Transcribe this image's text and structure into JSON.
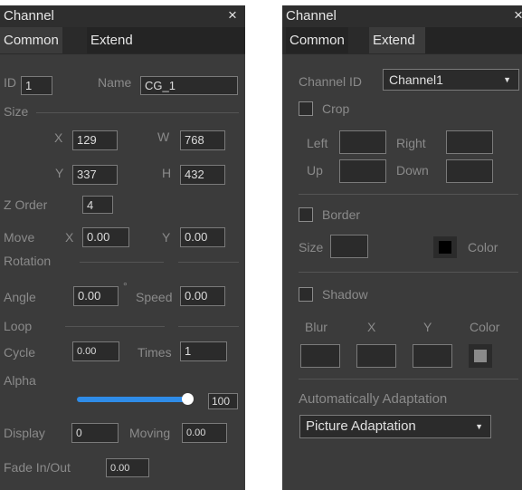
{
  "left_panel": {
    "title": "Channel",
    "close_glyph": "×",
    "tabs": [
      {
        "label": "Common",
        "active": true
      },
      {
        "label": "Extend",
        "active": false
      }
    ],
    "id_label": "ID",
    "id_value": "1",
    "name_label": "Name",
    "name_value": "CG_1",
    "size_section": "Size",
    "x_label": "X",
    "x_value": "129",
    "w_label": "W",
    "w_value": "768",
    "y_label": "Y",
    "y_value": "337",
    "h_label": "H",
    "h_value": "432",
    "zorder_label": "Z Order",
    "zorder_value": "4",
    "move_label": "Move",
    "move_x_label": "X",
    "move_x_value": "0.00",
    "move_y_label": "Y",
    "move_y_value": "0.00",
    "rotation_section": "Rotation",
    "angle_label": "Angle",
    "angle_value": "0.00",
    "degree_symbol": "°",
    "speed_label": "Speed",
    "speed_value": "0.00",
    "loop_section": "Loop",
    "cycle_label": "Cycle",
    "cycle_value": "0.00",
    "times_label": "Times",
    "times_value": "1",
    "alpha_label": "Alpha",
    "alpha_value": "100",
    "alpha_fraction": 1.0,
    "display_label": "Display",
    "display_value": "0",
    "moving_label": "Moving",
    "moving_value": "0.00",
    "fade_label": "Fade In/Out",
    "fade_value": "0.00"
  },
  "right_panel": {
    "title": "Channel",
    "close_glyph": "×",
    "tabs": [
      {
        "label": "Common",
        "active": false
      },
      {
        "label": "Extend",
        "active": true
      }
    ],
    "channel_id_label": "Channel ID",
    "channel_id_value": "Channel1",
    "crop_label": "Crop",
    "left_label": "Left",
    "right_label": "Right",
    "up_label": "Up",
    "down_label": "Down",
    "border_label": "Border",
    "border_size_label": "Size",
    "border_color_label": "Color",
    "shadow_label": "Shadow",
    "blur_label": "Blur",
    "shadow_x_label": "X",
    "shadow_y_label": "Y",
    "shadow_color_label": "Color",
    "auto_label": "Automatically Adaptation",
    "adaptation_value": "Picture Adaptation"
  },
  "colors": {
    "panel_bg": "#3b3b3b",
    "slider_fill": "#2f8ce8",
    "border_color_swatch": "#000000",
    "shadow_color_swatch": "#8a8a8a"
  },
  "icons": {
    "close": "close-icon",
    "dropdown": "chevron-down-icon"
  }
}
